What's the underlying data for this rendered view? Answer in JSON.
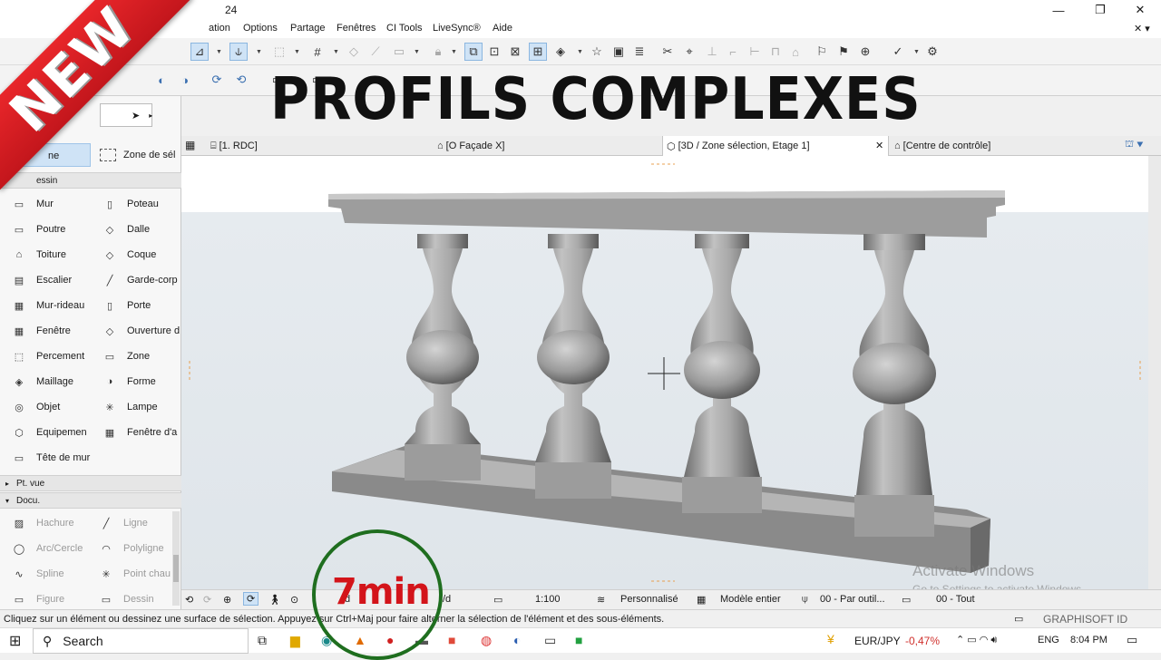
{
  "window": {
    "title": "24",
    "controls": [
      "—",
      "❐",
      "✕"
    ]
  },
  "menu": [
    "ation",
    "Options",
    "Partage",
    "Fenêtres",
    "CI Tools",
    "LiveSync®",
    "Aide"
  ],
  "overlay": {
    "headline": "PROFILS COMPLEXES",
    "banner": "NEW",
    "timer": "7min",
    "watermark_line1": "Activate Windows",
    "watermark_line2": "Go to Settings to activate Windows."
  },
  "palette": {
    "top_items": [
      "ne",
      "Zone de sél"
    ],
    "section_design": "essin",
    "tools": [
      [
        "Mur",
        "Poteau"
      ],
      [
        "Poutre",
        "Dalle"
      ],
      [
        "Toiture",
        "Coque"
      ],
      [
        "Escalier",
        "Garde-corp"
      ],
      [
        "Mur-rideau",
        "Porte"
      ],
      [
        "Fenêtre",
        "Ouverture d"
      ],
      [
        "Percement",
        "Zone"
      ],
      [
        "Maillage",
        "Forme"
      ],
      [
        "Objet",
        "Lampe"
      ],
      [
        "Equipemen",
        "Fenêtre d'a"
      ],
      [
        "Tête de mur",
        ""
      ]
    ],
    "section_ptvue": "Pt. vue",
    "section_docu": "Docu.",
    "doc_tools": [
      [
        "Hachure",
        "Ligne"
      ],
      [
        "Arc/Cercle",
        "Polyligne"
      ],
      [
        "Spline",
        "Point chau"
      ],
      [
        "Figure",
        "Dessin"
      ]
    ]
  },
  "tabs": [
    {
      "label": "[1. RDC]"
    },
    {
      "label": "[O Façade X]"
    },
    {
      "label": "[3D / Zone sélection, Etage 1]"
    },
    {
      "label": "[Centre de contrôle]"
    }
  ],
  "viewctl": {
    "scale": "1:100",
    "style": "Personnalisé",
    "model": "Modèle entier",
    "layer": "00 - Par outil...",
    "dims": "00 - Tout",
    "partial1": "d",
    "partial2": "/d"
  },
  "status": {
    "message": "Cliquez sur un élément ou dessinez une surface de sélection. Appuyez sur Ctrl+Maj pour faire alterner la sélection de l'élément et des sous-éléments.",
    "brand": "GRAPHISOFT ID"
  },
  "taskbar": {
    "search": "Search",
    "currency": "EUR/JPY",
    "change": "-0,47%",
    "lang": "ENG",
    "time": "8:04 PM"
  },
  "colors": {
    "accent": "#1f6e1f",
    "timer_text": "#d3141a",
    "banner": "#e8262a",
    "negative": "#d0312d"
  }
}
